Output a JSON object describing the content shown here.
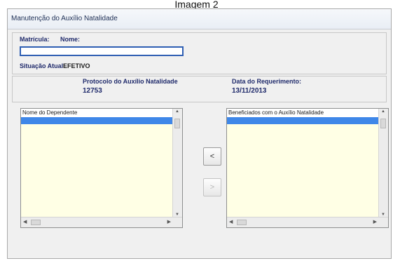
{
  "caption": "Imagem 2",
  "window": {
    "title": "Manutenção do Auxílio Natalidade"
  },
  "employee": {
    "matricula_label": "Matrícula:",
    "nome_label": "Nome:",
    "nome_value": "",
    "situacao_label": "Situação Atual:",
    "situacao_value": "EFETIVO"
  },
  "protocol": {
    "protocolo_label": "Protocolo do Auxílio Natalidade",
    "protocolo_value": "12753",
    "data_label": "Data do Requerimento:",
    "data_value": "13/11/2013"
  },
  "left_list": {
    "header": "Nome do Dependente"
  },
  "right_list": {
    "header": "Beneficiados com o Auxílio Natalidade"
  },
  "buttons": {
    "move_left": "<",
    "move_right": ">"
  }
}
